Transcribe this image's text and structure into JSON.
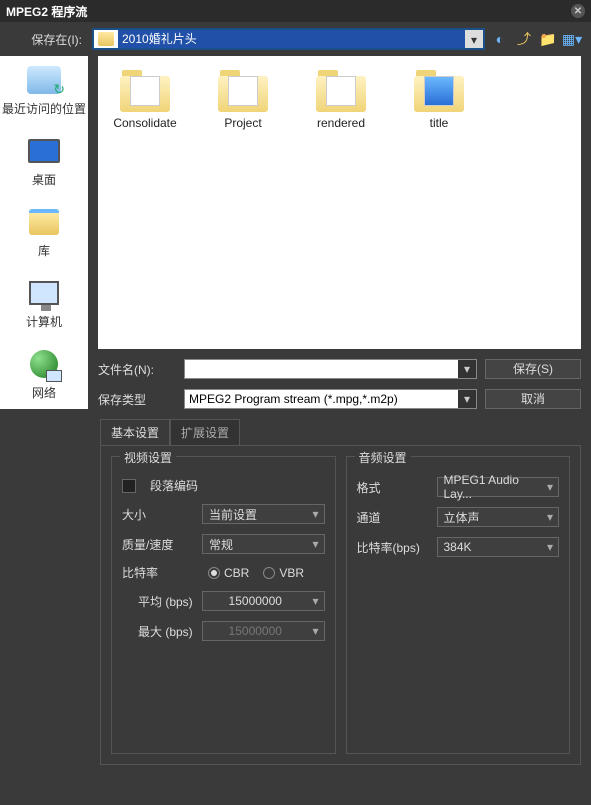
{
  "title": "MPEG2 程序流",
  "savein": {
    "label": "保存在(I):",
    "path": "2010婚礼片头"
  },
  "nav_icons": [
    "back",
    "up",
    "new-folder",
    "view"
  ],
  "sidebar": [
    {
      "key": "recent",
      "label": "最近访问的位置"
    },
    {
      "key": "desktop",
      "label": "桌面"
    },
    {
      "key": "libraries",
      "label": "库"
    },
    {
      "key": "computer",
      "label": "计算机"
    },
    {
      "key": "network",
      "label": "网络"
    }
  ],
  "folders": [
    {
      "name": "Consolidate"
    },
    {
      "name": "Project"
    },
    {
      "name": "rendered"
    },
    {
      "name": "title"
    }
  ],
  "filename": {
    "label": "文件名(N):",
    "value": ""
  },
  "filetype": {
    "label": "保存类型",
    "value": "MPEG2 Program stream (*.mpg,*.m2p)"
  },
  "buttons": {
    "save": "保存(S)",
    "cancel": "取消"
  },
  "tabs": {
    "basic": "基本设置",
    "extended": "扩展设置"
  },
  "video": {
    "legend": "视频设置",
    "segment_encoding": "段落编码",
    "size_label": "大小",
    "size_value": "当前设置",
    "quality_label": "质量/速度",
    "quality_value": "常规",
    "bitrate_label": "比特率",
    "cbr": "CBR",
    "vbr": "VBR",
    "avg_label": "平均 (bps)",
    "avg_value": "15000000",
    "max_label": "最大 (bps)",
    "max_value": "15000000"
  },
  "audio": {
    "legend": "音频设置",
    "format_label": "格式",
    "format_value": "MPEG1 Audio Lay...",
    "channel_label": "通道",
    "channel_value": "立体声",
    "bitrate_label": "比特率(bps)",
    "bitrate_value": "384K"
  }
}
